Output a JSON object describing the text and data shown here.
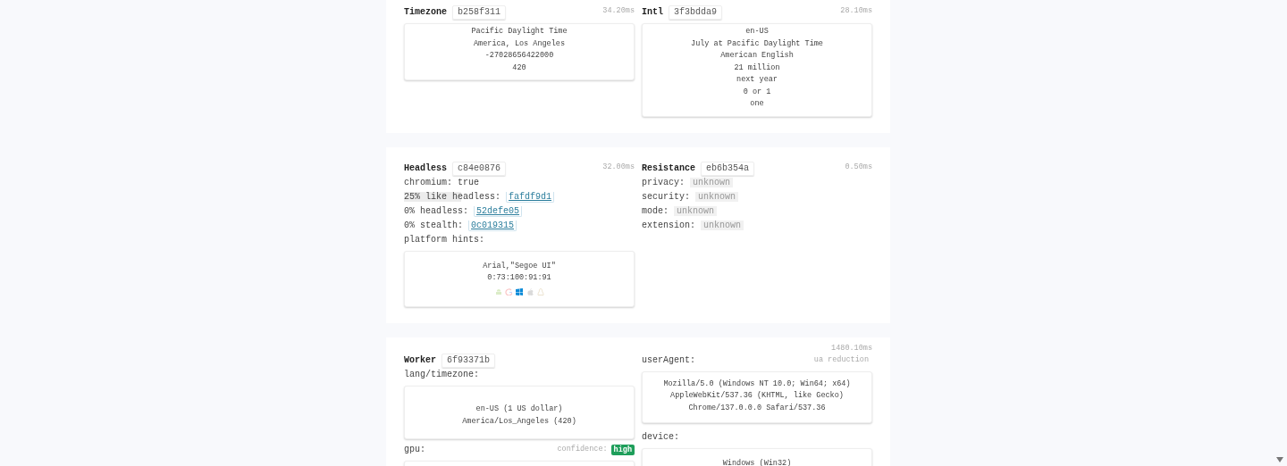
{
  "timezone": {
    "title": "Timezone",
    "hash": "b258f311",
    "time": "34.20ms",
    "lines": [
      "Pacific Daylight Time",
      "America, Los Angeles",
      "-27028656422000",
      "420"
    ]
  },
  "intl": {
    "title": "Intl",
    "hash": "3f3bdda9",
    "time": "28.10ms",
    "lines": [
      "en-US",
      "July at Pacific Daylight Time",
      "American English",
      "21 million",
      "next year",
      "0 or 1",
      "one"
    ]
  },
  "headless": {
    "title": "Headless",
    "hash": "c84e0876",
    "time": "32.00ms",
    "rows": [
      {
        "kind": "plain",
        "label": "chromium:",
        "value": "true"
      },
      {
        "kind": "link",
        "label": "25% like headless:",
        "value": "fafdf9d1"
      },
      {
        "kind": "link",
        "label": "0% headless:",
        "value": "52defe05"
      },
      {
        "kind": "link",
        "label": "0% stealth:",
        "value": "0c019315"
      }
    ],
    "hints_label": "platform hints:",
    "hints_lines": [
      "Arial,\"Segoe UI\"",
      "0:73:100:91:91"
    ],
    "platforms": [
      {
        "kind": "android",
        "selected": false
      },
      {
        "kind": "google",
        "selected": false
      },
      {
        "kind": "windows",
        "selected": true
      },
      {
        "kind": "apple",
        "selected": false
      },
      {
        "kind": "linux",
        "selected": false
      }
    ]
  },
  "resistance": {
    "title": "Resistance",
    "hash": "eb6b354a",
    "time": "0.50ms",
    "rows": [
      {
        "label": "privacy:",
        "value": "unknown"
      },
      {
        "label": "security:",
        "value": "unknown"
      },
      {
        "label": "mode:",
        "value": "unknown"
      },
      {
        "label": "extension:",
        "value": "unknown"
      }
    ]
  },
  "worker": {
    "time": "1480.10ms",
    "title": "Worker",
    "hash": "6f93371b",
    "lang_label": "lang/timezone:",
    "lang_lines": [
      "en-US (1 US dollar)",
      "America/Los_Angeles (420)"
    ],
    "gpu_label": "gpu:",
    "confidence_label": "confidence:",
    "confidence": "high",
    "ua_label": "userAgent:",
    "ua_note": "ua reduction",
    "ua_lines": [
      "Mozilla/5.0 (Windows NT 10.0; Win64; x64)",
      "AppleWebKit/537.36 (KHTML, like Gecko)",
      "Chrome/137.0.0.0 Safari/537.36"
    ],
    "device_label": "device:",
    "device_lines": [
      "Windows (Win32)"
    ]
  }
}
